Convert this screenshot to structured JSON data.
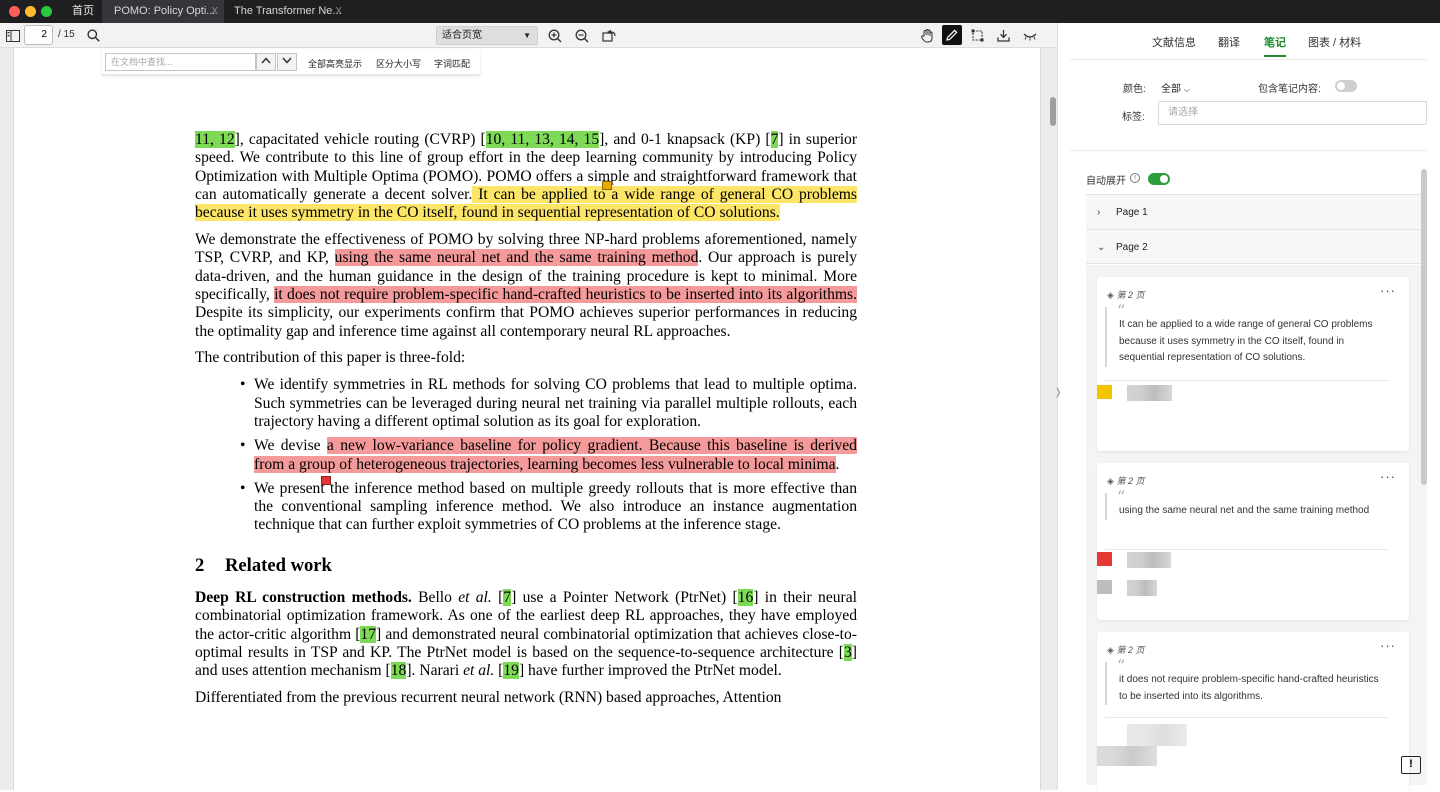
{
  "window": {
    "tabs": [
      {
        "label": "首页"
      },
      {
        "label": "POMO: Policy Opti..."
      },
      {
        "label": "The Transformer Ne..."
      }
    ],
    "close_glyph": "X"
  },
  "toolbar": {
    "current_page": "2",
    "total_pages": "/ 15",
    "zoom_option": "适合页宽",
    "icons": [
      "sidebar-toggle-icon",
      "search-icon",
      "zoom-in-icon",
      "zoom-out-icon",
      "rotate-icon",
      "hand-icon",
      "pen-icon",
      "crop-icon",
      "download-icon",
      "collapse-icon"
    ]
  },
  "find": {
    "placeholder": "在文档中查找...",
    "highlight_all": "全部高亮显示",
    "match_case": "区分大小写",
    "whole_word": "字词匹配"
  },
  "document": {
    "p1": {
      "refs_a": "11, 12",
      "t1": "], capacitated vehicle routing (CVRP) [",
      "refs_b": "10, 11, 13, 14, 15",
      "t2": "], and 0-1 knapsack (KP) [",
      "ref_c": "7",
      "t3": "] in superior speed. We contribute to this line of group effort in the deep learning community by introducing Policy Optimization with Multiple Optima (POMO). POMO offers a simple and straightforward framework that can automatically generate a decent solver.",
      "hl": " It can be applied to a wide range of general CO problems because it uses symmetry in the CO itself, found in sequential representation of CO solutions."
    },
    "p2": {
      "t1": "We demonstrate the effectiveness of POMO by solving three NP-hard problems aforementioned, namely TSP, CVRP, and KP, ",
      "hl1": "using the same neural net and the same training method",
      "t2": ". Our approach is purely data-driven, and the human guidance in the design of the training procedure is kept to minimal. More specifically, ",
      "hl2": "it does not require problem-specific hand-crafted heuristics to be inserted into its algorithms.",
      "t3": " Despite its simplicity, our experiments confirm that POMO achieves superior performances in reducing the optimality gap and inference time against all contemporary neural RL approaches."
    },
    "p3": "The contribution of this paper is three-fold:",
    "bullets": {
      "b1": "We identify symmetries in RL methods for solving CO problems that lead to multiple optima. Such symmetries can be leveraged during neural net training via parallel multiple rollouts, each trajectory having a different optimal solution as its goal for exploration.",
      "b2_pre": "We devise ",
      "b2_hl": "a new low-variance baseline for policy gradient. Because this baseline is derived from a group of heterogeneous trajectories, learning becomes less vulnerable to local minima",
      "b2_post": ".",
      "b3": "We present the inference method based on multiple greedy rollouts that is more effective than the conventional sampling inference method. We also introduce an instance augmentation technique that can further exploit symmetries of CO problems at the inference stage."
    },
    "section": {
      "num": "2",
      "title": "Related work"
    },
    "p4": {
      "bold": "Deep RL construction methods.",
      "t1": "  Bello ",
      "etal": "et al.",
      "t2": " [",
      "r1": "7",
      "t3": "] use a Pointer Network (PtrNet) [",
      "r2": "16",
      "t4": "] in their neural combinatorial optimization framework. As one of the earliest deep RL approaches, they have employed the actor-critic algorithm [",
      "r3": "17",
      "t5": "] and demonstrated neural combinatorial optimization that achieves close-to-optimal results in TSP and KP. The PtrNet model is based on the sequence-to-sequence architecture [",
      "r4": "3",
      "t6": "] and uses attention mechanism [",
      "r5": "18",
      "t7": "]. Narari ",
      "etal2": "et al.",
      "t8": " [",
      "r6": "19",
      "t9": "] have further improved the PtrNet model."
    },
    "p5": "Differentiated from the previous recurrent neural network (RNN) based approaches, Attention"
  },
  "panel": {
    "tabs": [
      {
        "label": "文献信息"
      },
      {
        "label": "翻译"
      },
      {
        "label": "笔记",
        "active": true
      },
      {
        "label": "图表 / 材料"
      }
    ],
    "color_label": "颜色:",
    "color_value": "全部",
    "include_label": "包含笔记内容:",
    "include_on": false,
    "tag_label": "标签:",
    "tag_placeholder": "请选择",
    "auto_expand_label": "自动展开",
    "auto_expand_on": true,
    "accordion": [
      {
        "label": "Page 1",
        "expanded": false
      },
      {
        "label": "Page 2",
        "expanded": true
      }
    ],
    "notes": [
      {
        "page": "第 2 页",
        "quote": "It can be applied to a wide range of general CO problems because it uses symmetry in the CO itself, found in sequential representation of CO solutions.",
        "color": "#f5c400"
      },
      {
        "page": "第 2 页",
        "quote": "using the same neural net and the same training method",
        "color": "#e53935"
      },
      {
        "page": "第 2 页",
        "quote": "it does not require problem-specific hand-crafted heuristics to be inserted into its algorithms.",
        "color": "#bdbdbd"
      }
    ],
    "more_glyph": "···"
  },
  "colors": {
    "accent": "#1f8a2f",
    "highlight_green": "#7ed957",
    "highlight_yellow": "#fde567",
    "highlight_red": "#f59a9a"
  }
}
